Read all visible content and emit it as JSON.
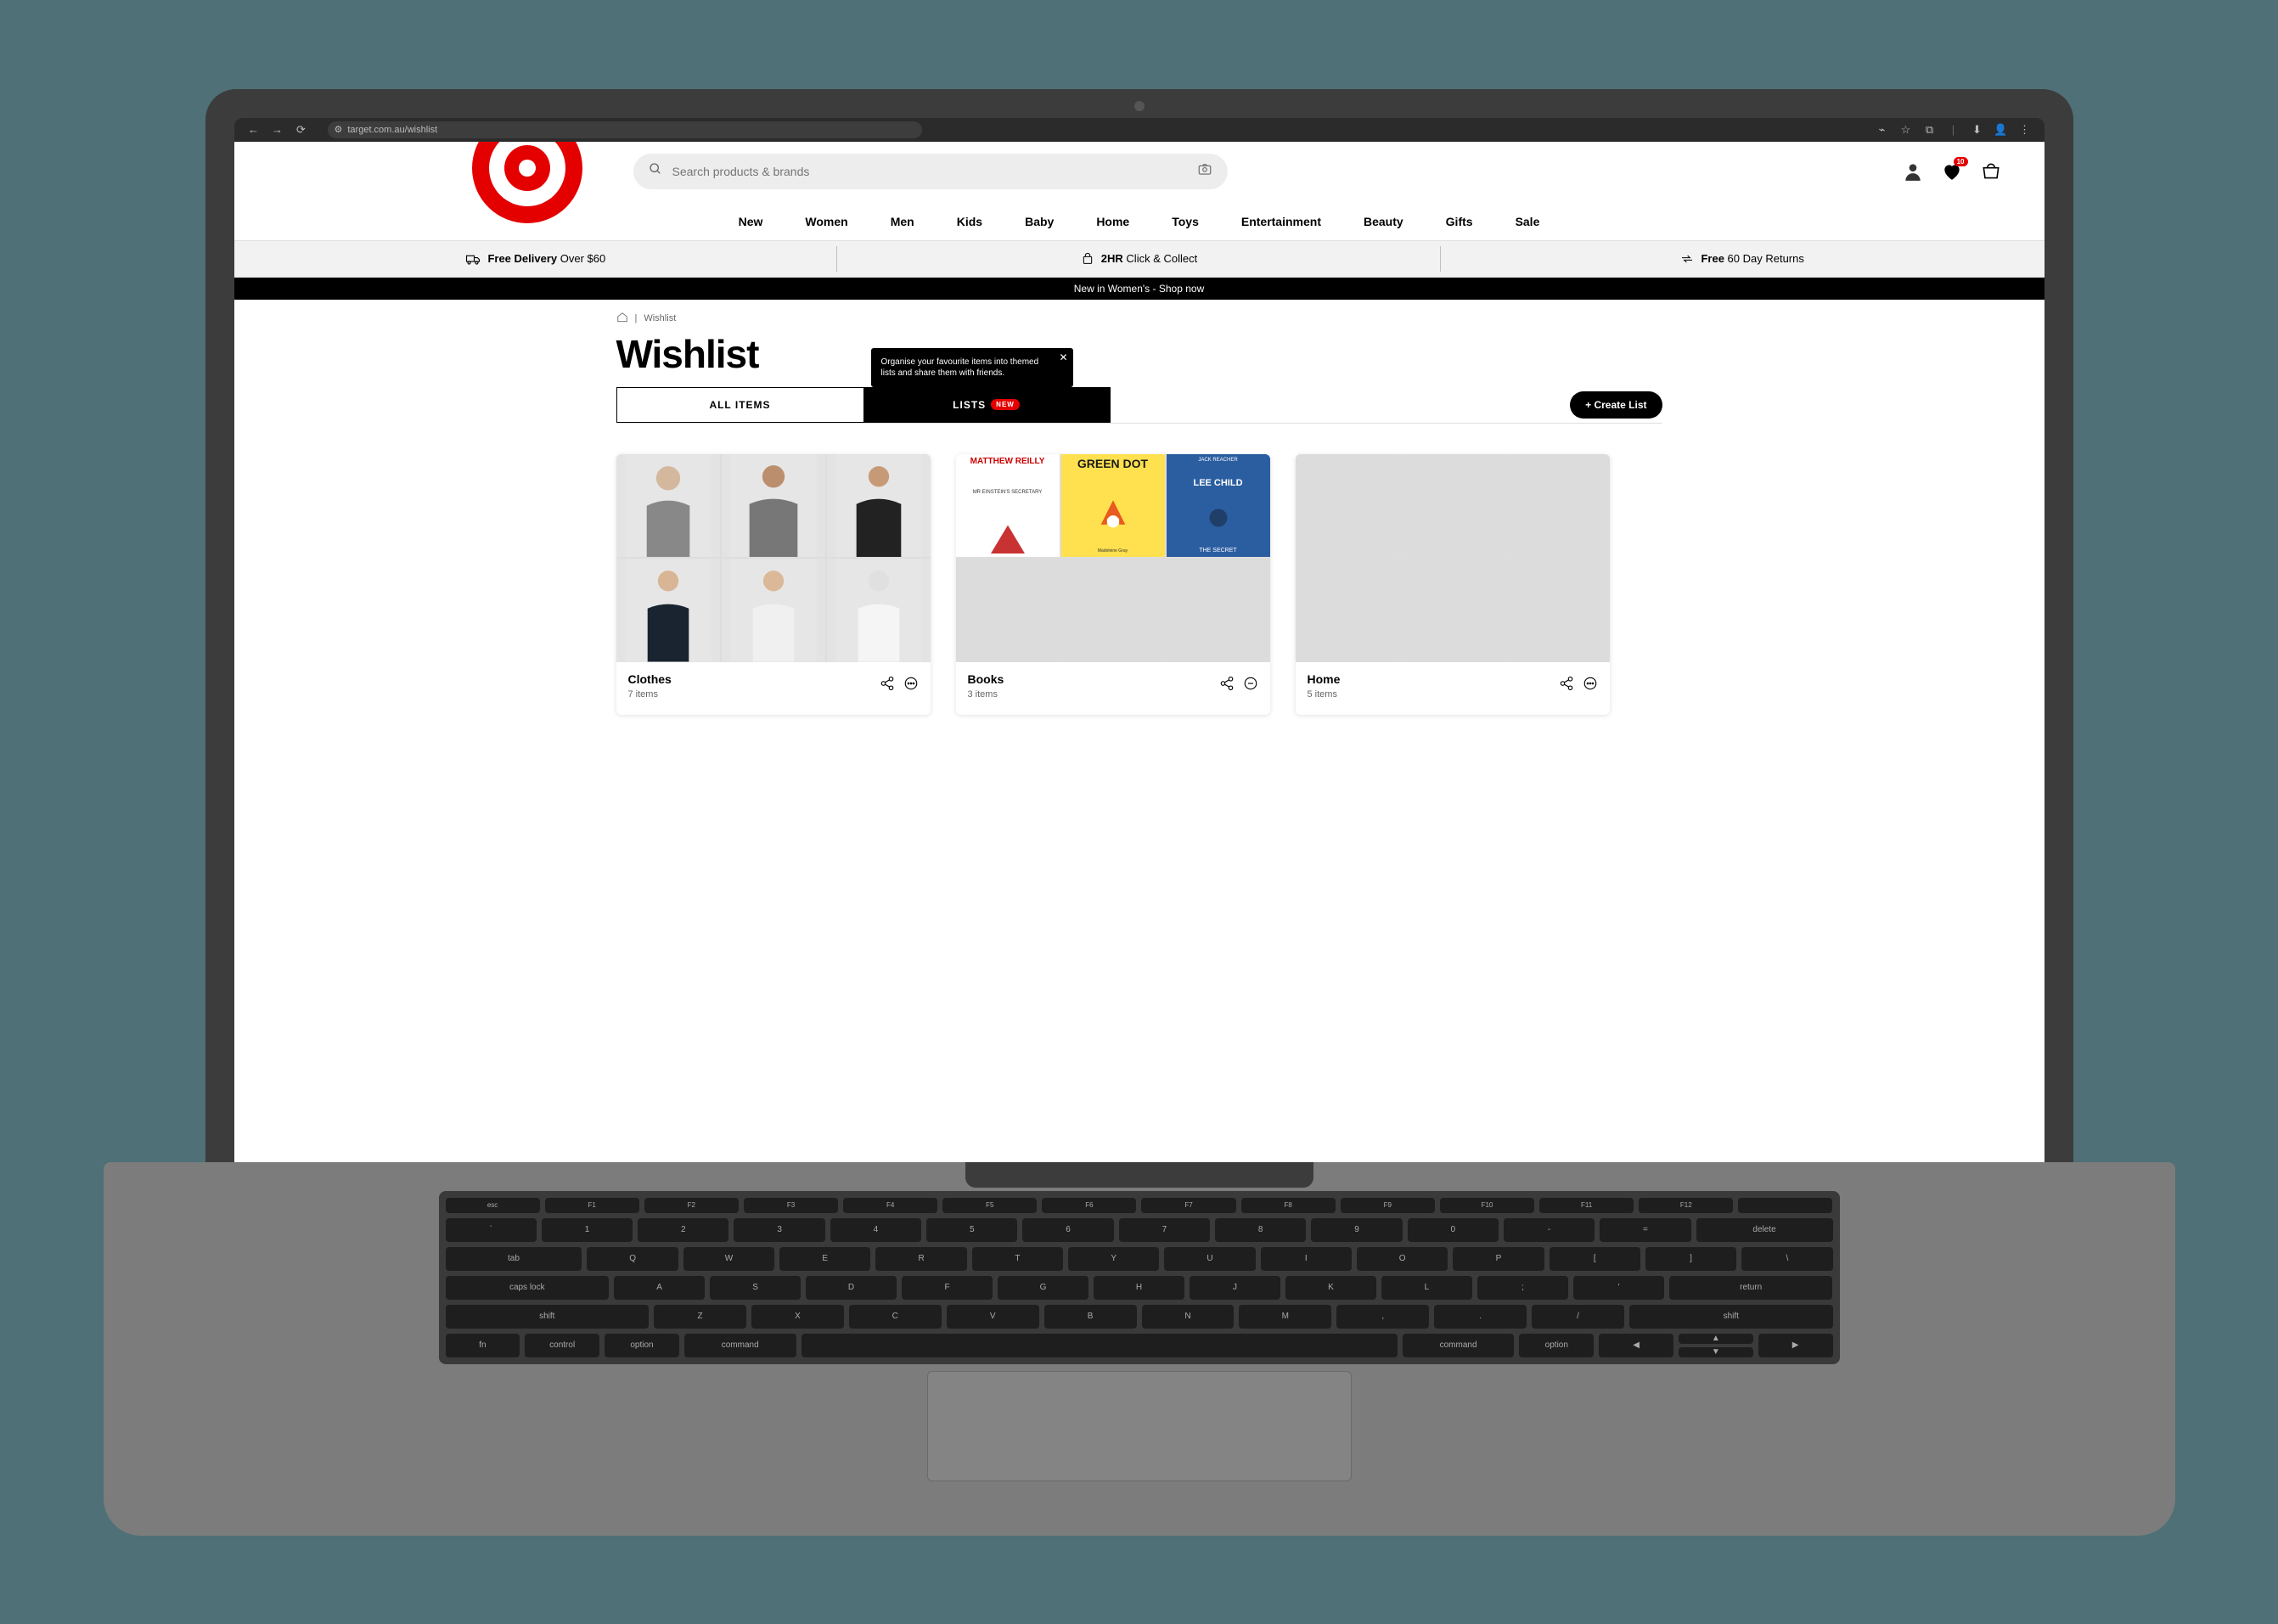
{
  "browser": {
    "url": "target.com.au/wishlist"
  },
  "search": {
    "placeholder": "Search products & brands"
  },
  "nav": {
    "items": [
      "New",
      "Women",
      "Men",
      "Kids",
      "Baby",
      "Home",
      "Toys",
      "Entertainment",
      "Beauty",
      "Gifts",
      "Sale"
    ]
  },
  "info": {
    "a": {
      "bold": "Free Delivery",
      "rest": " Over $60"
    },
    "b": {
      "bold": "2HR ",
      "rest": "Click & Collect"
    },
    "c": {
      "bold": "Free ",
      "rest": "60 Day Returns"
    }
  },
  "promo": {
    "text": "New in Women's - ",
    "link": "Shop now"
  },
  "breadcrumb": {
    "current": "Wishlist"
  },
  "title": "Wishlist",
  "tabs": {
    "all_label": "ALL ITEMS",
    "lists_label": "LISTS",
    "new_badge": "NEW"
  },
  "tooltip": {
    "text": "Organise your favourite items into themed lists and share them with friends."
  },
  "create_button": "+ Create List",
  "wishlist_badge": "10",
  "lists": [
    {
      "name": "Clothes",
      "count": "7 items"
    },
    {
      "name": "Books",
      "count": "3 items"
    },
    {
      "name": "Home",
      "count": "5 items"
    }
  ],
  "books": {
    "b1": {
      "author": "MATTHEW REILLY",
      "title": "MR EINSTEIN'S SECRETARY"
    },
    "b2": {
      "title": "GREEN DOT",
      "author": "Madeleine Gray"
    },
    "b3": {
      "line1": "JACK REACHER",
      "line2": "LEE CHILD",
      "line3": "THE SECRET"
    }
  },
  "keyboard": {
    "fn": [
      "esc",
      "F1",
      "F2",
      "F3",
      "F4",
      "F5",
      "F6",
      "F7",
      "F8",
      "F9",
      "F10",
      "F11",
      "F12",
      ""
    ],
    "r1": [
      "`",
      "1",
      "2",
      "3",
      "4",
      "5",
      "6",
      "7",
      "8",
      "9",
      "0",
      "-",
      "=",
      "delete"
    ],
    "r2": [
      "tab",
      "Q",
      "W",
      "E",
      "R",
      "T",
      "Y",
      "U",
      "I",
      "O",
      "P",
      "[",
      "]",
      "\\"
    ],
    "r3": [
      "caps lock",
      "A",
      "S",
      "D",
      "F",
      "G",
      "H",
      "J",
      "K",
      "L",
      ";",
      "'",
      "return"
    ],
    "r4": [
      "shift",
      "Z",
      "X",
      "C",
      "V",
      "B",
      "N",
      "M",
      ",",
      ".",
      "/",
      "shift"
    ],
    "r5": [
      "fn",
      "control",
      "option",
      "command",
      "",
      "command",
      "option",
      "◀",
      "▲▼",
      "▶"
    ]
  }
}
